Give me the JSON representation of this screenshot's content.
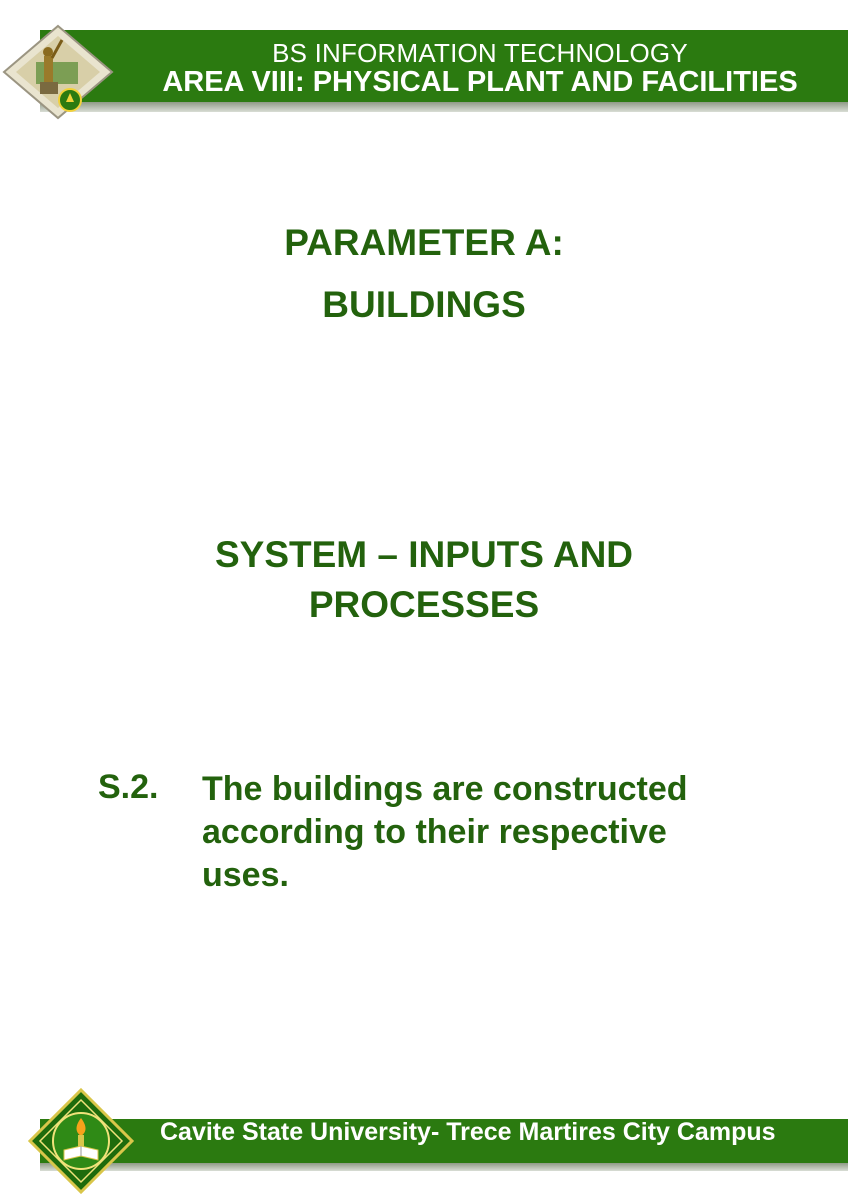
{
  "header": {
    "program": "BS INFORMATION TECHNOLOGY",
    "area": "AREA VIII: PHYSICAL PLANT AND FACILITIES"
  },
  "parameter": {
    "line1": "PARAMETER A:",
    "line2": "BUILDINGS"
  },
  "section": {
    "line1": "SYSTEM – INPUTS AND",
    "line2": "PROCESSES"
  },
  "criterion": {
    "number": "S.2.",
    "text": "The buildings are constructed according to their respective uses."
  },
  "footer": {
    "campus": "Cavite State University- Trece Martires City Campus"
  },
  "colors": {
    "brand_green": "#2b7a10",
    "text_green": "#23620d"
  },
  "icons": {
    "top_logo": "statue-diamond-emblem",
    "bottom_logo": "university-seal"
  }
}
